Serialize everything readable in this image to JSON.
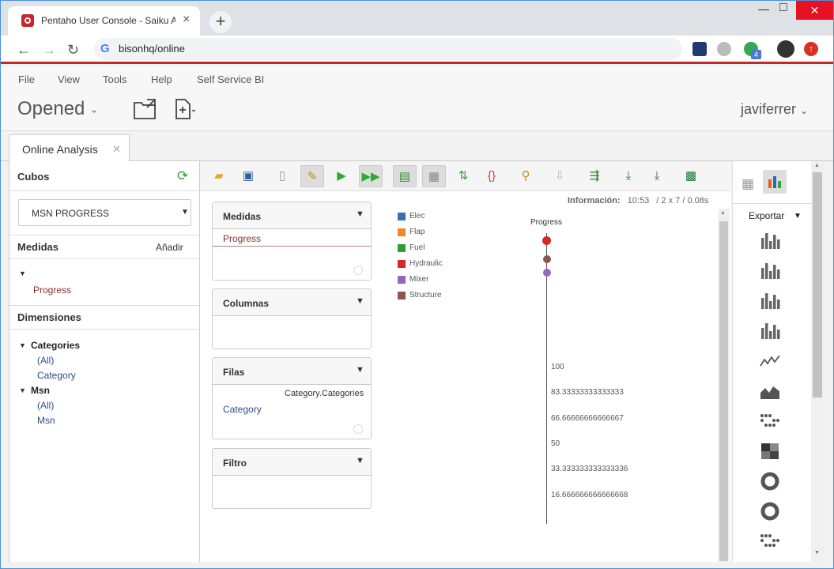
{
  "browser": {
    "tab_title": "Pentaho User Console - Saiku An",
    "url": "bisonhq/online",
    "ext_badge": "4"
  },
  "menubar": [
    "File",
    "View",
    "Tools",
    "Help",
    "Self Service BI"
  ],
  "header": {
    "perspective": "Opened",
    "user": "javiferrer"
  },
  "content_tab": "Online Analysis",
  "left": {
    "cubes_title": "Cubos",
    "cube_selected": "MSN PROGRESS",
    "measures_title": "Medidas",
    "add_label": "Añadir",
    "measure": "Progress",
    "dimensions_title": "Dimensiones",
    "dimensions": [
      {
        "name": "Categories",
        "levels": [
          "(All)",
          "Category"
        ]
      },
      {
        "name": "Msn",
        "levels": [
          "(All)",
          "Msn"
        ]
      }
    ]
  },
  "workspace": {
    "info_label": "Información:",
    "info_time": "10:53",
    "info_size": "2 x 7",
    "info_duration": "0.08s",
    "boxes": {
      "measures_title": "Medidas",
      "measure_item": "Progress",
      "columns_title": "Columnas",
      "rows_title": "Filas",
      "rows_item_right": "Category.Categories",
      "rows_item": "Category",
      "filter_title": "Filtro"
    }
  },
  "chart_data": {
    "type": "scatter",
    "x_label": "Progress",
    "legend": [
      {
        "name": "Elec",
        "color": "#3a6fb0"
      },
      {
        "name": "Flap",
        "color": "#f2862a"
      },
      {
        "name": "Fuel",
        "color": "#2ca02c"
      },
      {
        "name": "Hydraulic",
        "color": "#d62728"
      },
      {
        "name": "Mixer",
        "color": "#9467bd"
      },
      {
        "name": "Structure",
        "color": "#8c564b"
      }
    ],
    "points": [
      {
        "color": "#d62728"
      },
      {
        "color": "#8c564b"
      },
      {
        "color": "#9467bd"
      }
    ],
    "y_ticks": [
      "100",
      "83.33333333333333",
      "66.66666666666667",
      "50",
      "33.333333333333336",
      "16.666666666666668"
    ]
  },
  "right": {
    "export_label": "Exportar"
  }
}
